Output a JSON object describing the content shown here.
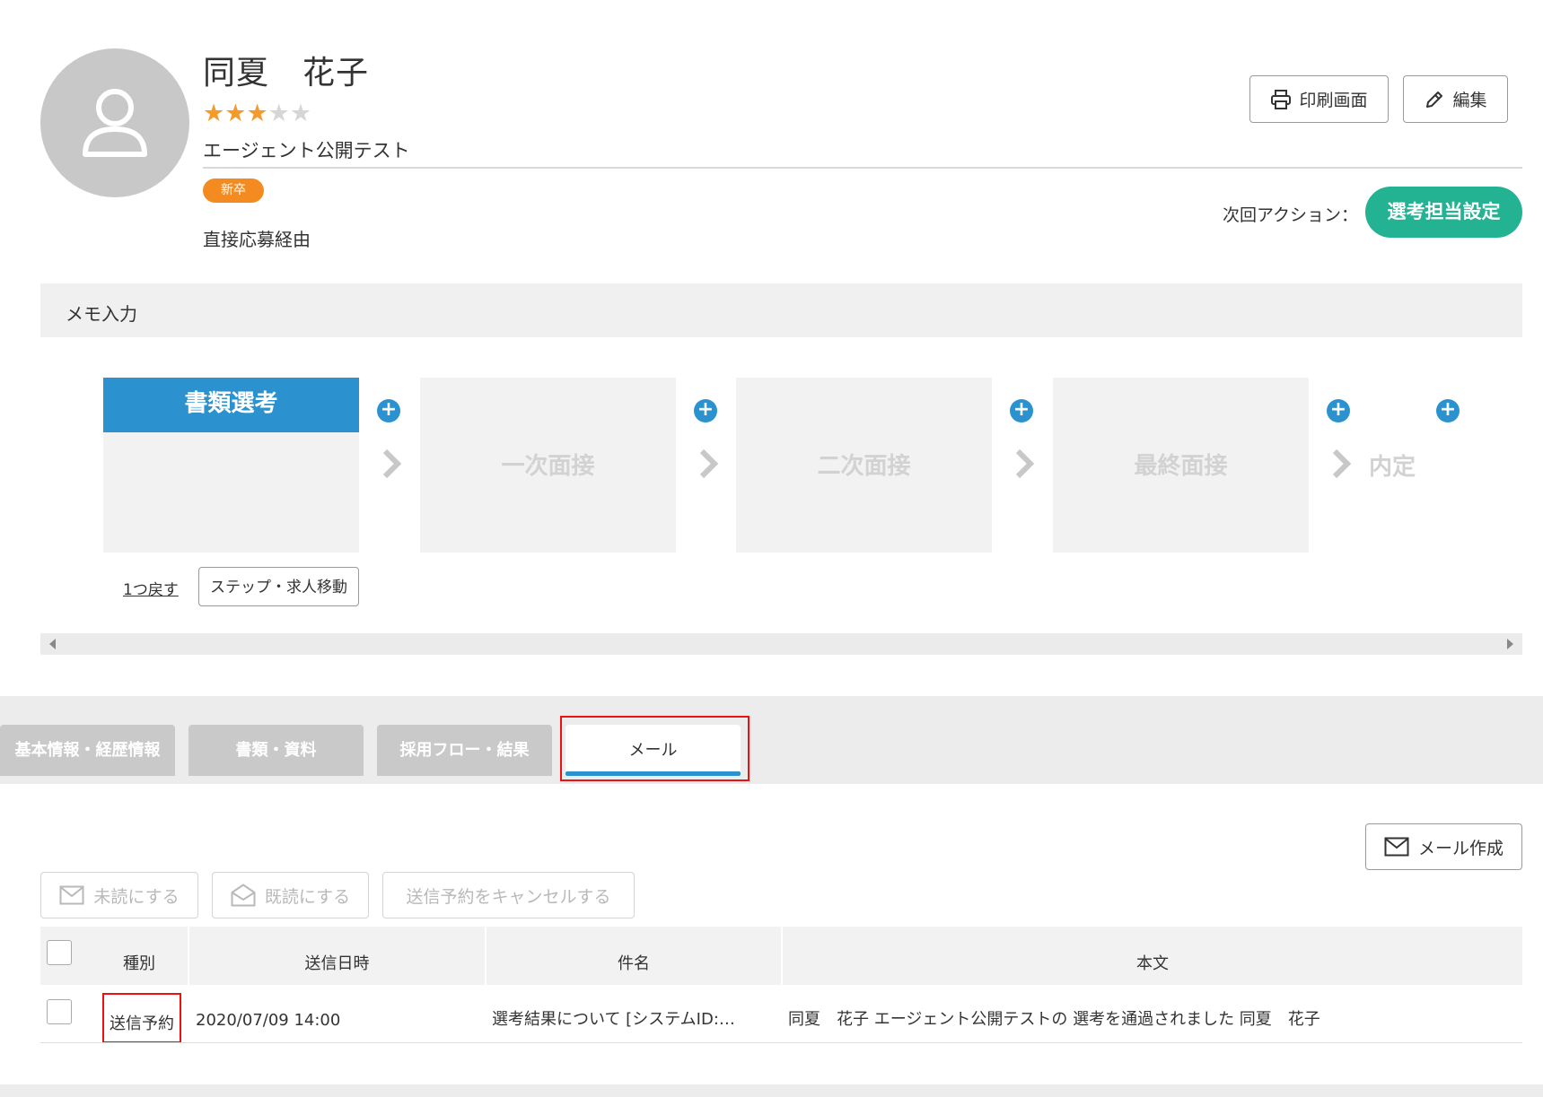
{
  "candidate": {
    "name": "同夏　花子",
    "rating": 3,
    "rating_max": 5,
    "company": "エージェント公開テスト",
    "badge": "新卒",
    "source": "直接応募経由"
  },
  "header": {
    "print_label": "印刷画面",
    "edit_label": "編集",
    "next_action_label": "次回アクション：",
    "next_action_button": "選考担当設定"
  },
  "memo": {
    "label": "メモ入力"
  },
  "flow": {
    "steps": [
      {
        "label": "書類選考",
        "active": true
      },
      {
        "label": "一次面接",
        "active": false
      },
      {
        "label": "二次面接",
        "active": false
      },
      {
        "label": "最終面接",
        "active": false
      },
      {
        "label": "内定",
        "active": false
      }
    ],
    "back_label": "1つ戻す",
    "move_label": "ステップ・求人移動"
  },
  "tabs": [
    {
      "label": "基本情報・経歴情報",
      "active": false
    },
    {
      "label": "書類・資料",
      "active": false
    },
    {
      "label": "採用フロー・結果",
      "active": false
    },
    {
      "label": "メール",
      "active": true
    }
  ],
  "mail": {
    "compose_label": "メール作成",
    "mark_unread_label": "未読にする",
    "mark_read_label": "既読にする",
    "cancel_schedule_label": "送信予約をキャンセルする",
    "columns": [
      "種別",
      "送信日時",
      "件名",
      "本文"
    ],
    "rows": [
      {
        "type": "送信予約",
        "sent_at": "2020/07/09 14:00",
        "subject": "選考結果について [システムID:…",
        "body": "同夏　花子 エージェント公開テストの 選考を通過されました 同夏　花子"
      }
    ]
  },
  "colors": {
    "accent_blue": "#2b92cf",
    "action_green": "#23b392",
    "badge_orange": "#f38b21",
    "star_on": "#f39a2b",
    "highlight_red": "#ee1111"
  }
}
